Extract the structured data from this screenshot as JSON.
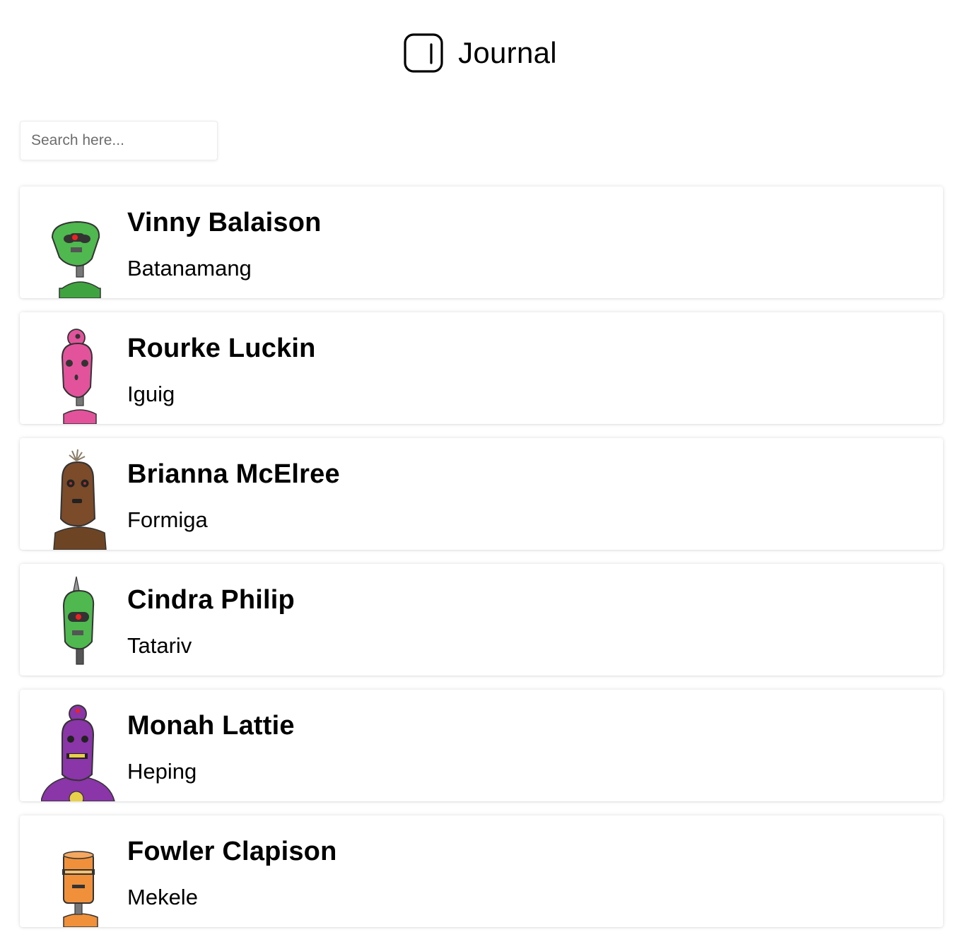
{
  "header": {
    "title": "Journal",
    "logo_icon": "rounded-square-logo-icon"
  },
  "search": {
    "placeholder": "Search here..."
  },
  "contacts": [
    {
      "name": "Vinny Balaison",
      "city": "Batanamang",
      "avatar_icon": "robot-avatar-icon",
      "color": "#4fb84f"
    },
    {
      "name": "Rourke Luckin",
      "city": "Iguig",
      "avatar_icon": "robot-avatar-icon",
      "color": "#e2539c"
    },
    {
      "name": "Brianna McElree",
      "city": "Formiga",
      "avatar_icon": "robot-avatar-icon",
      "color": "#7b4b2a"
    },
    {
      "name": "Cindra Philip",
      "city": "Tatariv",
      "avatar_icon": "robot-avatar-icon",
      "color": "#4fb84f"
    },
    {
      "name": "Monah Lattie",
      "city": "Heping",
      "avatar_icon": "robot-avatar-icon",
      "color": "#8a35a8"
    },
    {
      "name": "Fowler Clapison",
      "city": "Mekele",
      "avatar_icon": "robot-avatar-icon",
      "color": "#f0903a"
    }
  ]
}
